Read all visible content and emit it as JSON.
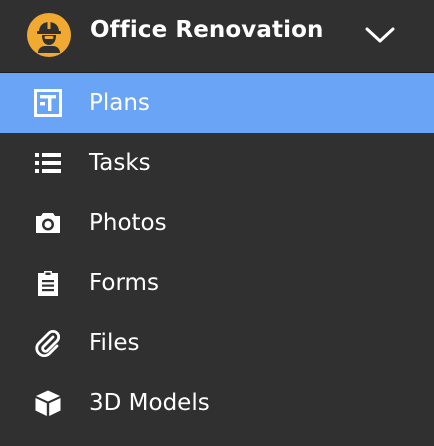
{
  "project": {
    "title": "Office Renovation",
    "logo_icon": "construction-worker-icon",
    "logo_color": "#f0a931",
    "dropdown_icon": "chevron-down-icon"
  },
  "colors": {
    "background": "#303030",
    "active_item": "#6aa4f6",
    "text": "#ffffff"
  },
  "nav": {
    "active_index": 0,
    "items": [
      {
        "label": "Plans",
        "icon": "plans-icon"
      },
      {
        "label": "Tasks",
        "icon": "list-icon"
      },
      {
        "label": "Photos",
        "icon": "camera-icon"
      },
      {
        "label": "Forms",
        "icon": "clipboard-icon"
      },
      {
        "label": "Files",
        "icon": "paperclip-icon"
      },
      {
        "label": "3D Models",
        "icon": "cube-icon"
      }
    ]
  }
}
